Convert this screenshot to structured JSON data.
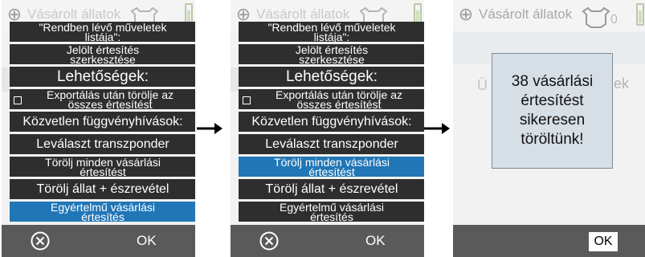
{
  "topbar": {
    "title": "Vásárolt állatok",
    "cow_count": "0"
  },
  "menu": {
    "items": [
      {
        "lines": [
          "\"Rendben lévő műveletek",
          "listája\":"
        ]
      },
      {
        "lines": [
          "Jelölt értesítés",
          "szerkesztése"
        ]
      },
      {
        "lines": [
          "Lehetőségek:"
        ]
      },
      {
        "lines": [
          "Exportálás után törölje az",
          "összes értesítést"
        ]
      },
      {
        "lines": [
          "Közvetlen függvényhívások:"
        ]
      },
      {
        "lines": [
          "Leválaszt transzponder"
        ]
      },
      {
        "lines": [
          "Törölj minden vásárlási",
          "értesítést"
        ]
      },
      {
        "lines": [
          "Törölj állat + észrevétel"
        ]
      },
      {
        "lines": [
          "Egyértelmű vásárlási",
          "értesítés"
        ]
      }
    ]
  },
  "bottombar": {
    "ok_label": "OK"
  },
  "dialog": {
    "lines": [
      "38 vásárlási",
      "értesítést",
      "sikeresen",
      "töröltünk!"
    ]
  },
  "background_faint": {
    "left": "Ü",
    "right": "ek"
  },
  "colors": {
    "menu_item": "#2e2e2e",
    "menu_selected": "#2176b6",
    "bottombar": "#5a5a5a",
    "dialog_bg": "#d6dee6"
  }
}
